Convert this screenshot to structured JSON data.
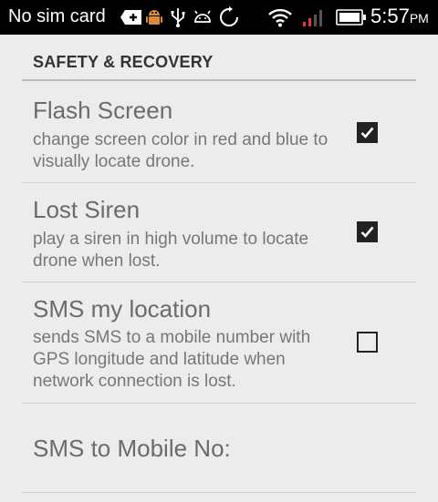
{
  "status_bar": {
    "carrier": "No sim card",
    "time": "5:57",
    "ampm": "PM",
    "icons": [
      "add-notification-icon",
      "android-debug-icon",
      "usb-icon",
      "android-icon",
      "sync-icon",
      "wifi-icon",
      "no-signal-icon",
      "battery-icon"
    ]
  },
  "section": {
    "title": "SAFETY & RECOVERY"
  },
  "prefs": [
    {
      "title": "Flash Screen",
      "summary": "change screen color in red and blue to visually locate drone.",
      "checked": true
    },
    {
      "title": "Lost Siren",
      "summary": "play a siren in high volume to locate drone when lost.",
      "checked": true
    },
    {
      "title": "SMS my location",
      "summary": "sends SMS to a mobile number with GPS longitude and latitude when network connection is lost.",
      "checked": false
    },
    {
      "title": "SMS to Mobile No:"
    }
  ],
  "colors": {
    "status_bar": "#000000",
    "background": "#ececec",
    "signal_warning": "#e53935"
  }
}
